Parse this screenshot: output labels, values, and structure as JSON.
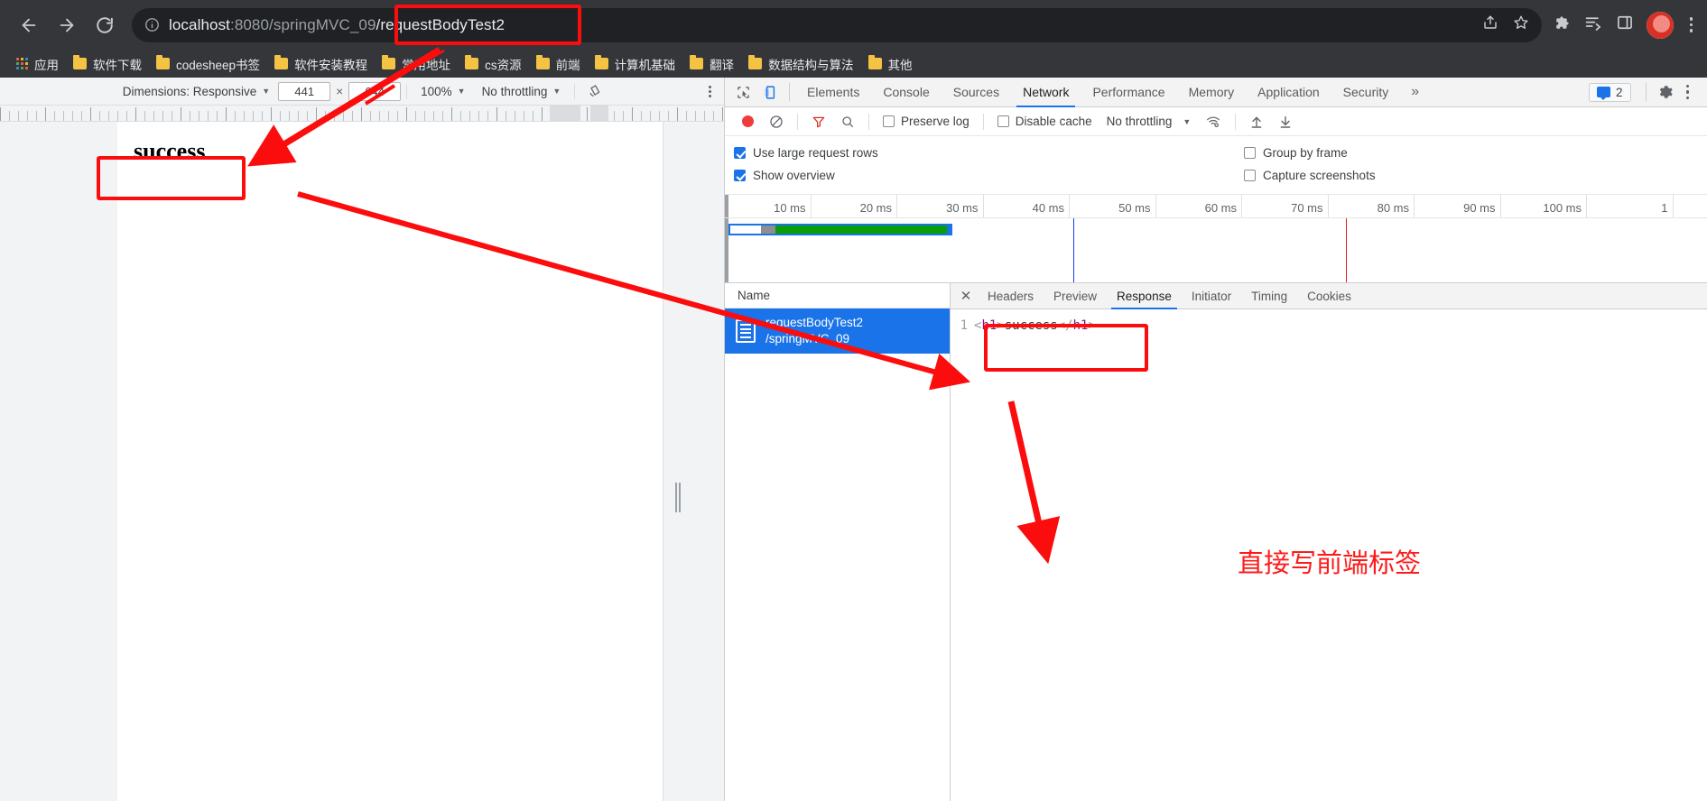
{
  "browser": {
    "nav": {
      "back_label": "Back",
      "forward_label": "Forward",
      "reload_label": "Reload"
    },
    "omnibox": {
      "info_icon": "info-circle-icon",
      "url_host": "localhost",
      "url_rest": ":8080/springMVC_09",
      "url_highlight": "/requestBodyTest2",
      "full_url": "localhost:8080/springMVC_09/requestBodyTest2",
      "share_icon": "share-icon",
      "star_icon": "bookmark-star-icon"
    },
    "toolbar_icons": {
      "extensions": "puzzle-piece-icon",
      "reading_list": "reading-list-icon",
      "side_panel": "side-panel-icon",
      "profile": "profile-avatar-icon"
    },
    "bookmarks": [
      {
        "label": "应用",
        "icon": "apps-grid-icon"
      },
      {
        "label": "软件下载",
        "icon": "folder-icon"
      },
      {
        "label": "codesheep书签",
        "icon": "folder-icon"
      },
      {
        "label": "软件安装教程",
        "icon": "folder-icon"
      },
      {
        "label": "常用地址",
        "icon": "folder-icon"
      },
      {
        "label": "cs资源",
        "icon": "folder-icon"
      },
      {
        "label": "前端",
        "icon": "folder-icon"
      },
      {
        "label": "计算机基础",
        "icon": "folder-icon"
      },
      {
        "label": "翻译",
        "icon": "folder-icon"
      },
      {
        "label": "数据结构与算法",
        "icon": "folder-icon"
      },
      {
        "label": "其他",
        "icon": "folder-icon"
      }
    ]
  },
  "device_toolbar": {
    "dimensions_label": "Dimensions: Responsive",
    "width_value": "441",
    "height_value": "644",
    "x_separator": "×",
    "zoom_value": "100%",
    "throttling_value": "No throttling",
    "rotate_icon": "rotate-icon",
    "menu_icon": "kebab-menu-icon"
  },
  "page": {
    "heading": "success"
  },
  "devtools": {
    "inspect_icon": "inspect-element-icon",
    "device_icon": "device-toolbar-icon",
    "tabs": [
      {
        "label": "Elements",
        "active": false
      },
      {
        "label": "Console",
        "active": false
      },
      {
        "label": "Sources",
        "active": false
      },
      {
        "label": "Network",
        "active": true
      },
      {
        "label": "Performance",
        "active": false
      },
      {
        "label": "Memory",
        "active": false
      },
      {
        "label": "Application",
        "active": false
      },
      {
        "label": "Security",
        "active": false
      }
    ],
    "overflow_label": "»",
    "issues_count": "2",
    "issues_icon": "issues-speech-bubble-icon",
    "settings_icon": "gear-icon",
    "more_icon": "kebab-menu-icon"
  },
  "network": {
    "toolbar": {
      "record_icon": "record-button-icon",
      "clear_icon": "clear-no-entry-icon",
      "filter_icon": "filter-funnel-icon",
      "search_icon": "search-magnifier-icon",
      "preserve_log_label": "Preserve log",
      "preserve_log_checked": false,
      "disable_cache_label": "Disable cache",
      "disable_cache_checked": false,
      "throttling_value": "No throttling",
      "wifi_icon": "network-conditions-wifi-icon",
      "import_icon": "import-har-up-arrow-icon",
      "export_icon": "export-har-down-arrow-icon"
    },
    "options": [
      {
        "label": "Use large request rows",
        "checked": true
      },
      {
        "label": "Group by frame",
        "checked": false
      },
      {
        "label": "Show overview",
        "checked": true
      },
      {
        "label": "Capture screenshots",
        "checked": false
      }
    ],
    "overview": {
      "ticks": [
        "10 ms",
        "20 ms",
        "30 ms",
        "40 ms",
        "50 ms",
        "60 ms",
        "70 ms",
        "80 ms",
        "90 ms",
        "100 ms",
        "1"
      ],
      "dom_content_loaded_color": "#1a3ee8",
      "load_event_color": "#e81a1a",
      "bar_color": "#1a73e8",
      "download_color": "#0a9d0a"
    },
    "list": {
      "column_header": "Name",
      "rows": [
        {
          "name": "requestBodyTest2",
          "path": "/springMVC_09",
          "icon": "document-icon",
          "selected": true
        }
      ]
    },
    "detail": {
      "close_label": "✕",
      "tabs": [
        {
          "label": "Headers",
          "active": false
        },
        {
          "label": "Preview",
          "active": false
        },
        {
          "label": "Response",
          "active": true
        },
        {
          "label": "Initiator",
          "active": false
        },
        {
          "label": "Timing",
          "active": false
        },
        {
          "label": "Cookies",
          "active": false
        }
      ],
      "response_body": {
        "line_number": "1",
        "segments": [
          {
            "text": "<",
            "kind": "punct"
          },
          {
            "text": "h1",
            "kind": "tag"
          },
          {
            "text": ">",
            "kind": "punct"
          },
          {
            "text": "success",
            "kind": "text"
          },
          {
            "text": "</",
            "kind": "punct"
          },
          {
            "text": "h1",
            "kind": "tag"
          },
          {
            "text": ">",
            "kind": "punct"
          }
        ]
      }
    }
  },
  "annotations": {
    "note_text": "直接写前端标签",
    "highlight_color": "#fc0d0d",
    "boxes": [
      {
        "name": "url-path-highlight"
      },
      {
        "name": "page-heading-highlight"
      },
      {
        "name": "response-body-highlight"
      }
    ]
  }
}
